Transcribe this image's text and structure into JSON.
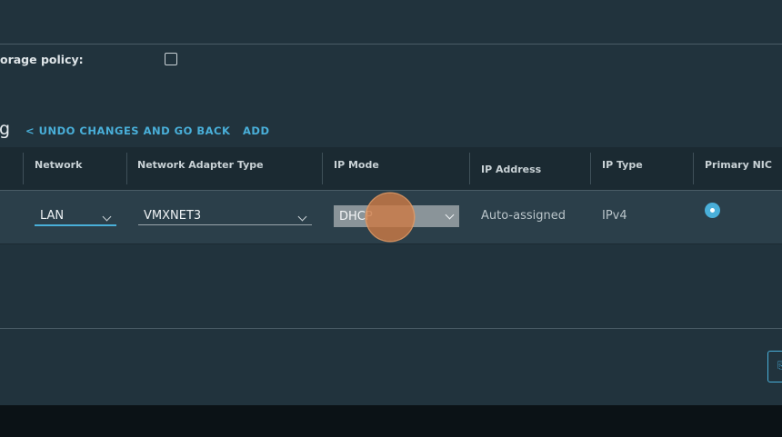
{
  "storage": {
    "label": "orage policy:"
  },
  "network_section": {
    "title": "g",
    "undo_label": "< UNDO CHANGES AND GO BACK",
    "add_label": "ADD"
  },
  "table": {
    "headers": {
      "network": "Network",
      "adapter_type": "Network Adapter Type",
      "ip_mode": "IP Mode",
      "ip_address": "IP Address",
      "ip_type": "IP Type",
      "primary_nic": "Primary NIC"
    },
    "row": {
      "network": "LAN",
      "adapter_type": "VMXNET3",
      "ip_mode": "DHCP",
      "ip_address": "Auto-assigned",
      "ip_type": "IPv4"
    }
  },
  "footer": {
    "button_icon": "⎘"
  },
  "colors": {
    "accent": "#49afd9",
    "panel_bg": "#21333d",
    "row_bg": "#2b3f4a",
    "cursor": "#cc7a45"
  }
}
